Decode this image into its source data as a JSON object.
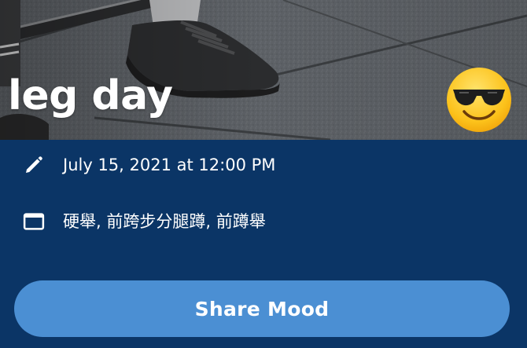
{
  "post": {
    "title": "leg day",
    "mood_icon": "sunglasses-emoji",
    "hero_image": "gym-floor-sneaker-photo"
  },
  "details": {
    "date_icon": "pencil-icon",
    "date_text": "July 15, 2021 at 12:00 PM",
    "exercises_icon": "calendar-icon",
    "exercises_text": "硬舉, 前跨步分腿蹲, 前蹲舉"
  },
  "actions": {
    "share_label": "Share Mood"
  },
  "colors": {
    "background": "#0b3566",
    "button": "#4b8fd3",
    "text": "#ffffff"
  }
}
